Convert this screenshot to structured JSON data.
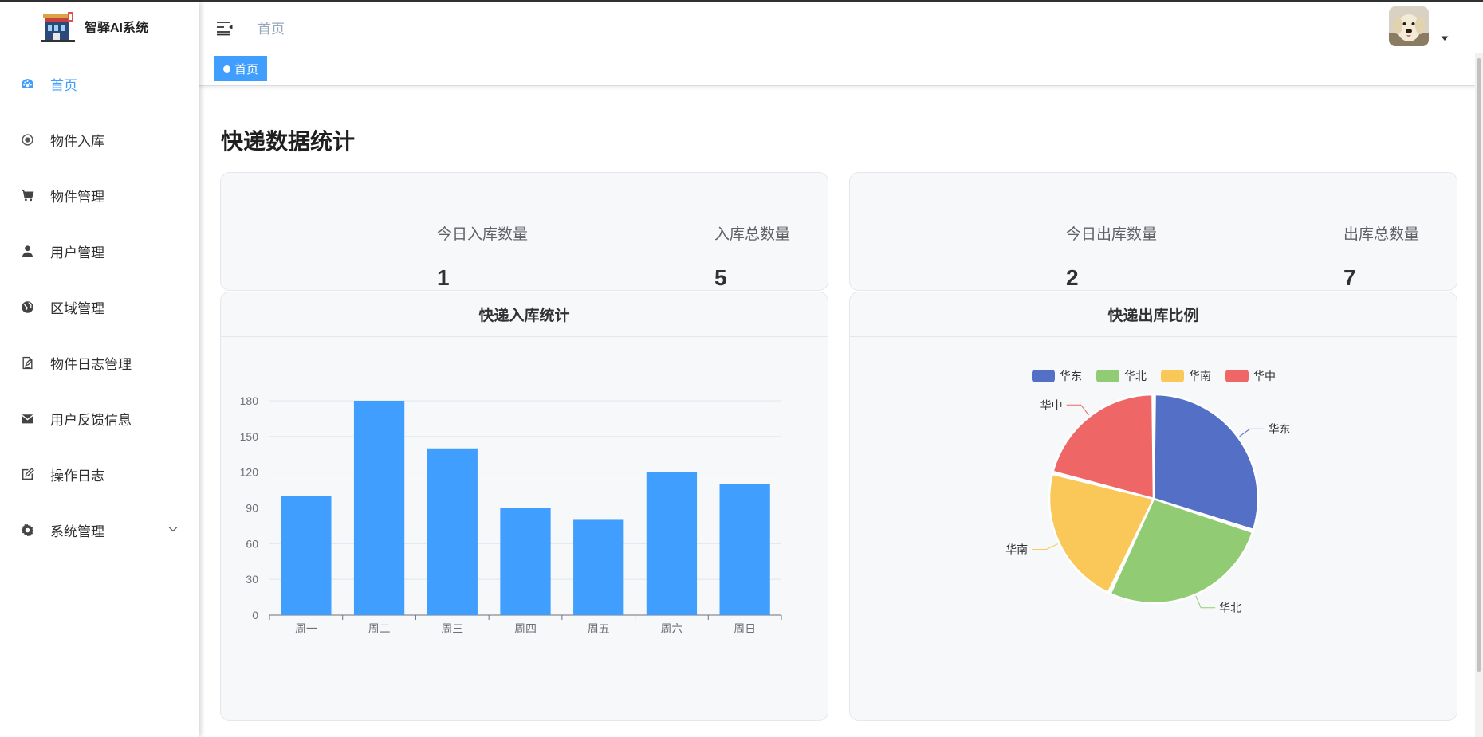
{
  "app": {
    "title": "智驿AI系统"
  },
  "sidebar": {
    "items": [
      {
        "label": "首页",
        "icon": "dashboard-icon",
        "active": true
      },
      {
        "label": "物件入库",
        "icon": "radio-circle-icon"
      },
      {
        "label": "物件管理",
        "icon": "shopping-cart-icon"
      },
      {
        "label": "用户管理",
        "icon": "user-icon"
      },
      {
        "label": "区域管理",
        "icon": "globe-icon"
      },
      {
        "label": "物件日志管理",
        "icon": "edit-document-icon"
      },
      {
        "label": "用户反馈信息",
        "icon": "mail-icon"
      },
      {
        "label": "操作日志",
        "icon": "edit-icon"
      },
      {
        "label": "系统管理",
        "icon": "gear-icon",
        "expandable": true
      }
    ]
  },
  "header": {
    "breadcrumb": "首页"
  },
  "tags": [
    {
      "label": "首页",
      "active": true
    }
  ],
  "main": {
    "title": "快递数据统计",
    "inbound": {
      "today_label": "今日入库数量",
      "today_value": "1",
      "total_label": "入库总数量",
      "total_value": "5"
    },
    "outbound": {
      "today_label": "今日出库数量",
      "today_value": "2",
      "total_label": "出库总数量",
      "total_value": "7"
    },
    "bar_chart_title": "快递入库统计",
    "pie_chart_title": "快递出库比例"
  },
  "colors": {
    "accent": "#409eff",
    "bar": "#409eff",
    "pie": [
      "#5470c6",
      "#91cc75",
      "#fac858",
      "#ee6666"
    ]
  },
  "chart_data": [
    {
      "type": "bar",
      "title": "快递入库统计",
      "categories": [
        "周一",
        "周二",
        "周三",
        "周四",
        "周五",
        "周六",
        "周日"
      ],
      "values": [
        100,
        180,
        140,
        90,
        80,
        120,
        110
      ],
      "ylim": [
        0,
        180
      ],
      "yticks": [
        0,
        30,
        60,
        90,
        120,
        150,
        180
      ],
      "grid": true
    },
    {
      "type": "pie",
      "title": "快递出库比例",
      "legend": [
        "华东",
        "华北",
        "华南",
        "华中"
      ],
      "legend_position": "top",
      "slices": [
        {
          "name": "华东",
          "value": 30
        },
        {
          "name": "华北",
          "value": 27
        },
        {
          "name": "华南",
          "value": 22
        },
        {
          "name": "华中",
          "value": 21
        }
      ]
    }
  ]
}
